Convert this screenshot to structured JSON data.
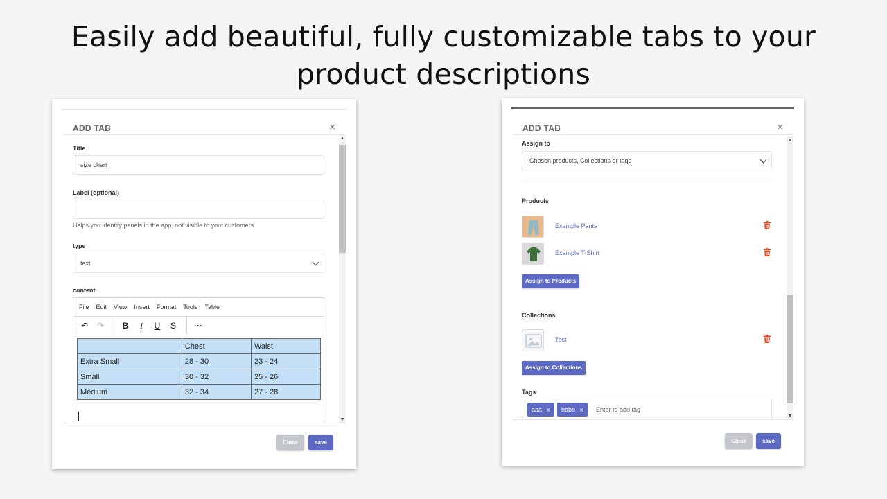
{
  "headline": {
    "line1": "Easily add beautiful, fully customizable tabs to your",
    "line2": "product descriptions"
  },
  "left_modal": {
    "title": "ADD TAB",
    "close_glyph": "×",
    "title_field": {
      "label": "Title",
      "value": "size chart"
    },
    "label_field": {
      "label": "Label (optional)",
      "value": "",
      "help": "Helps you identify panels in the app, not visible to your customers"
    },
    "type_field": {
      "label": "type",
      "value": "text"
    },
    "content_label": "content",
    "editor_menu": [
      "File",
      "Edit",
      "View",
      "Insert",
      "Format",
      "Tools",
      "Table"
    ],
    "editor_toolbar": {
      "undo": "↶",
      "redo": "↷",
      "bold": "B",
      "italic": "I",
      "underline": "U",
      "strike": "S",
      "more": "···"
    },
    "size_table": {
      "headers": [
        "",
        "Chest",
        "Waist"
      ],
      "rows": [
        [
          "Extra Small",
          "28 - 30",
          "23 - 24"
        ],
        [
          "Small",
          "30 - 32",
          "25 - 26"
        ],
        [
          "Medium",
          "32 - 34",
          "27 - 28"
        ]
      ]
    },
    "footer": {
      "close_label": "Close",
      "save_label": "save"
    }
  },
  "right_modal": {
    "title": "ADD TAB",
    "close_glyph": "×",
    "assign_to": {
      "label": "Assign to",
      "value": "Chosen products, Collections or tags"
    },
    "products": {
      "label": "Products",
      "items": [
        {
          "name": "Example Pants",
          "thumb": "pants-thumbnail"
        },
        {
          "name": "Example T-Shirt",
          "thumb": "tshirt-thumbnail"
        }
      ],
      "assign_button": "Assign to Products"
    },
    "collections": {
      "label": "Collections",
      "items": [
        {
          "name": "Test",
          "thumb": "image-placeholder-icon"
        }
      ],
      "assign_button": "Assign to Collections"
    },
    "tags": {
      "label": "Tags",
      "items": [
        "aaa",
        "bbbb"
      ],
      "remove_glyph": "x",
      "placeholder": "Enter to add tag"
    },
    "footer": {
      "close_label": "Close",
      "save_label": "save"
    }
  },
  "colors": {
    "accent": "#5c6ac4",
    "trash": "#e8502b",
    "close_button": "#c3c7cb",
    "table_fill": "#c4e0f6"
  }
}
